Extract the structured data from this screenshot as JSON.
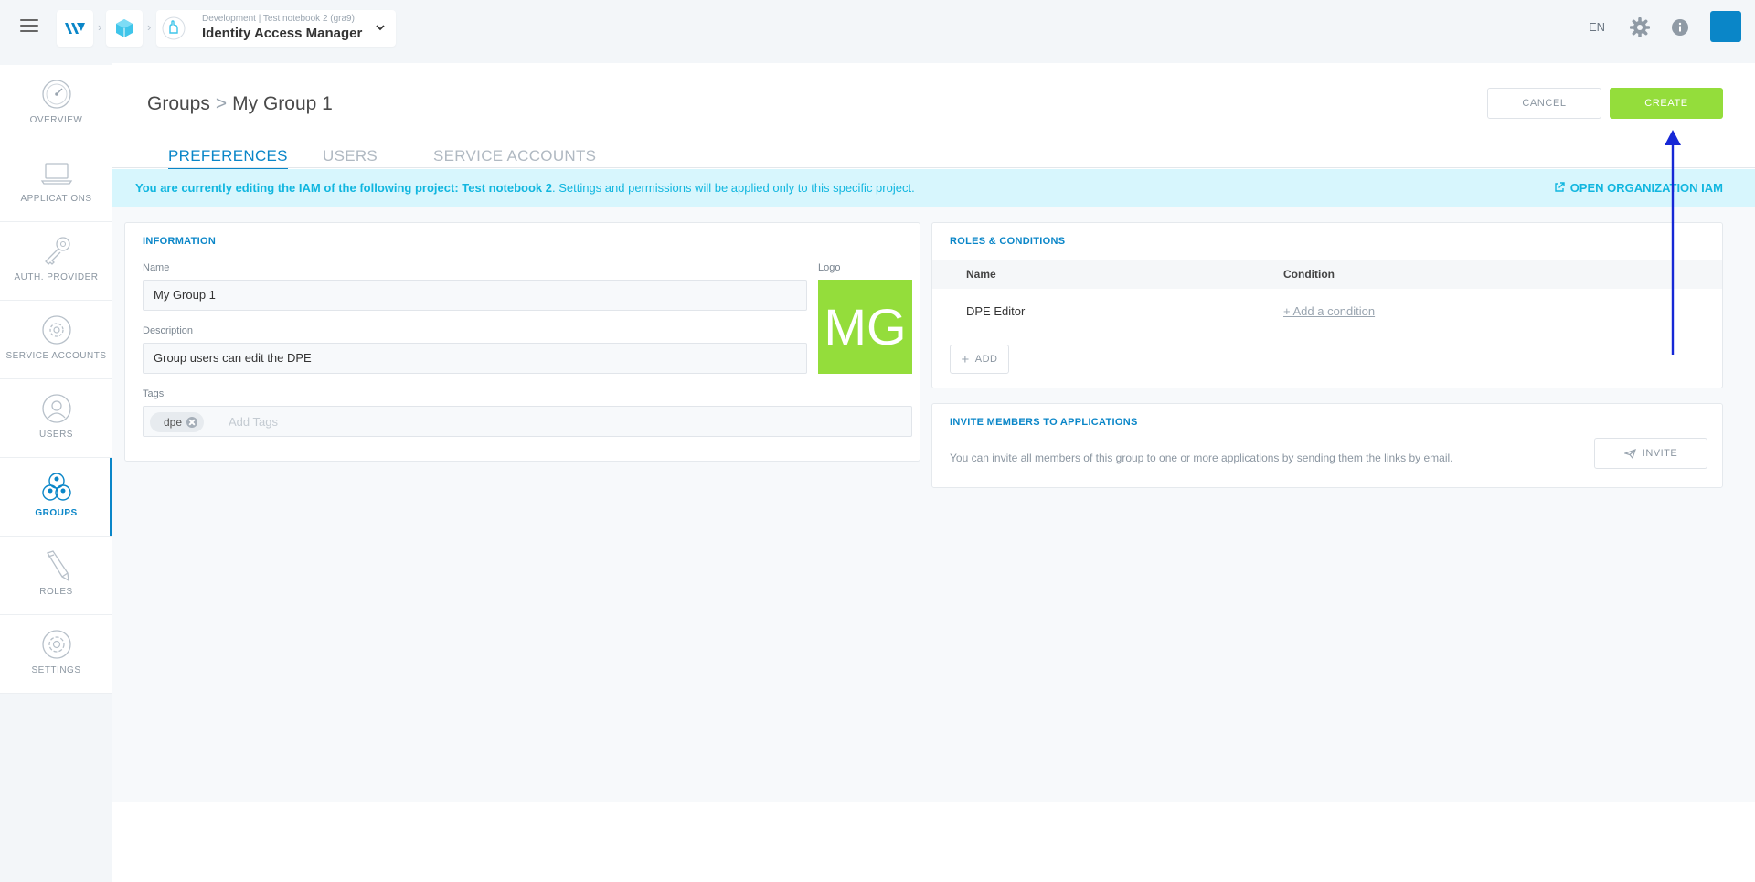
{
  "header": {
    "app_sub": "Development | Test notebook 2 (gra9)",
    "app_name": "Identity Access Manager",
    "lang": "EN",
    "icons": [
      "hamburger-icon",
      "ovh-logo-icon",
      "cube-icon",
      "iam-hand-icon",
      "chevron-down-icon",
      "gear-icon",
      "info-icon"
    ],
    "brand_color": "#0a86c8"
  },
  "sidebar": {
    "items": [
      {
        "label": "OVERVIEW",
        "icon": "dial-icon"
      },
      {
        "label": "APPLICATIONS",
        "icon": "laptop-icon"
      },
      {
        "label": "AUTH. PROVIDER",
        "icon": "key-icon"
      },
      {
        "label": "SERVICE ACCOUNTS",
        "icon": "gear-circle-icon"
      },
      {
        "label": "USERS",
        "icon": "user-icon"
      },
      {
        "label": "GROUPS",
        "icon": "group-icon",
        "active": true
      },
      {
        "label": "ROLES",
        "icon": "pencil-icon"
      },
      {
        "label": "SETTINGS",
        "icon": "settings-icon"
      }
    ]
  },
  "page": {
    "breadcrumb_root": "Groups",
    "breadcrumb_current": "My Group 1",
    "cancel_label": "CANCEL",
    "create_label": "CREATE",
    "create_color": "#94dd3b"
  },
  "tabs": [
    {
      "label": "PREFERENCES",
      "active": true
    },
    {
      "label": "USERS",
      "active": false
    },
    {
      "label": "SERVICE ACCOUNTS",
      "active": false
    }
  ],
  "notice": {
    "bold": "You are currently editing the IAM of the following project: Test notebook 2",
    "rest": ". Settings and permissions will be applied only to this specific project.",
    "link": "OPEN ORGANIZATION IAM"
  },
  "information": {
    "title": "INFORMATION",
    "name_label": "Name",
    "name_value": "My Group 1",
    "description_label": "Description",
    "description_value": "Group users can edit the DPE",
    "tags_label": "Tags",
    "tags": [
      "dpe"
    ],
    "tags_placeholder": "Add Tags",
    "logo_label": "Logo",
    "logo_text": "MG"
  },
  "roles": {
    "title": "ROLES & CONDITIONS",
    "col_name": "Name",
    "col_condition": "Condition",
    "rows": [
      {
        "name": "DPE Editor",
        "condition": "+ Add a condition"
      }
    ],
    "add_label": "ADD"
  },
  "invite": {
    "title": "INVITE MEMBERS TO APPLICATIONS",
    "text": "You can invite all members of this group to one or more applications by sending them the links by email.",
    "button": "INVITE"
  }
}
